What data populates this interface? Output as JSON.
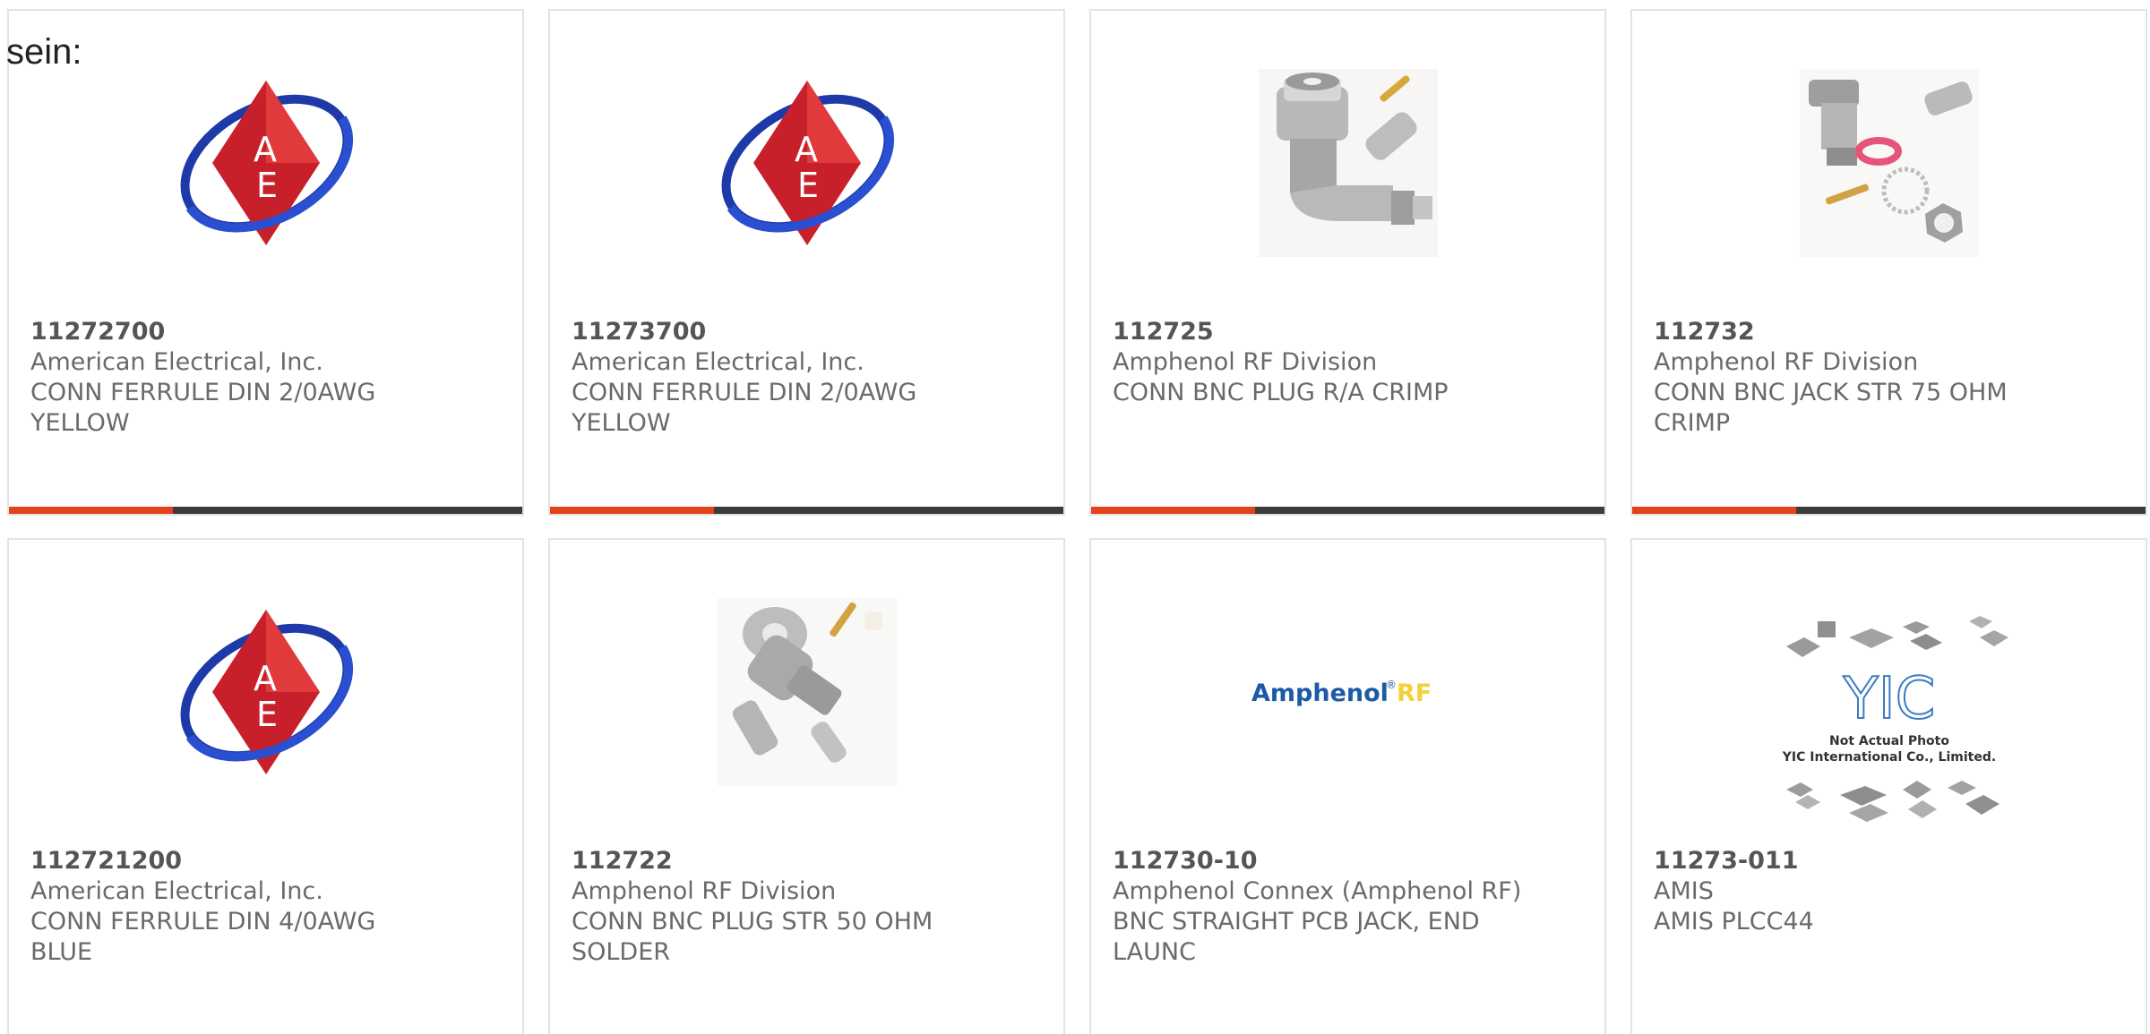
{
  "intro_text": "sein:",
  "colors": {
    "accent": "#e3421a",
    "bar_dark": "#3b3b3b",
    "text": "#6a6a6a"
  },
  "products": [
    {
      "part_number": "11272700",
      "manufacturer": "American Electrical, Inc.",
      "description_line1": "CONN FERRULE DIN 2/0AWG",
      "description_line2": "YELLOW",
      "image": "ae-logo"
    },
    {
      "part_number": "11273700",
      "manufacturer": "American Electrical, Inc.",
      "description_line1": "CONN FERRULE DIN 2/0AWG",
      "description_line2": "YELLOW",
      "image": "ae-logo"
    },
    {
      "part_number": "112725",
      "manufacturer": "Amphenol RF Division",
      "description_line1": "CONN BNC PLUG R/A CRIMP",
      "description_line2": "",
      "image": "bnc-right-angle-plug"
    },
    {
      "part_number": "112732",
      "manufacturer": "Amphenol RF Division",
      "description_line1": "CONN BNC JACK STR 75 OHM",
      "description_line2": "CRIMP",
      "image": "bnc-jack-kit"
    },
    {
      "part_number": "112721200",
      "manufacturer": "American Electrical, Inc.",
      "description_line1": "CONN FERRULE DIN 4/0AWG",
      "description_line2": "BLUE",
      "image": "ae-logo"
    },
    {
      "part_number": "112722",
      "manufacturer": "Amphenol RF Division",
      "description_line1": "CONN BNC PLUG STR 50 OHM",
      "description_line2": "SOLDER",
      "image": "bnc-straight-plug"
    },
    {
      "part_number": "112730-10",
      "manufacturer": "Amphenol Connex (Amphenol RF)",
      "description_line1": "BNC STRAIGHT PCB JACK, END",
      "description_line2": "LAUNC",
      "image": "amphenol-rf-logo"
    },
    {
      "part_number": "11273-011",
      "manufacturer": "AMIS",
      "description_line1": "AMIS PLCC44",
      "description_line2": "",
      "image": "yic-placeholder"
    }
  ],
  "logos": {
    "ae_letters_top": "A",
    "ae_letters_bottom": "E",
    "amphenol_text": "Amphenol",
    "amphenol_rf": "RF",
    "amphenol_reg": "®",
    "yic_title": "YIC",
    "yic_line1": "Not Actual Photo",
    "yic_line2": "YIC International Co., Limited."
  }
}
